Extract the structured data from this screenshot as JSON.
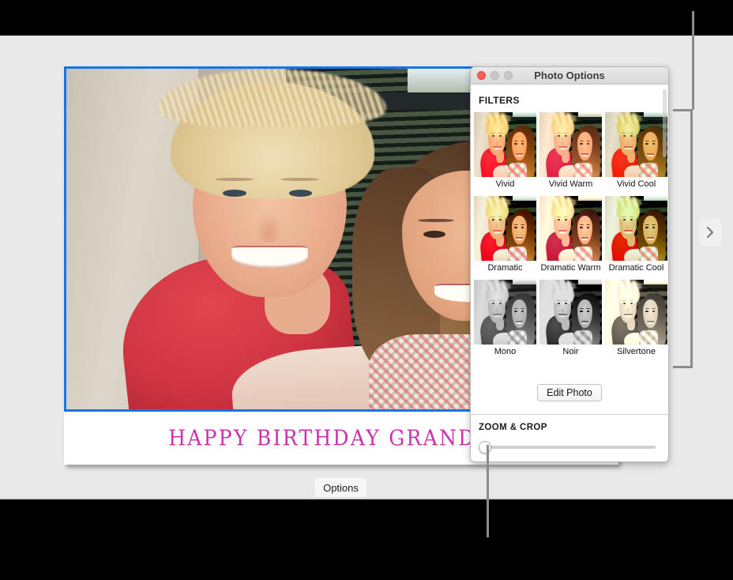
{
  "slide": {
    "caption_text": "HAPPY BIRTHDAY GRANDMA",
    "caption_color": "#cc2fae",
    "selection_border_color": "#1a73e8",
    "photo_alt": "Grandmother with short blonde hair hugging a smiling girl with long brown hair, outdoors by a concrete wall and dark louvered window"
  },
  "toolbar": {
    "options_label": "Options"
  },
  "nav": {
    "next_icon": "chevron-right-icon"
  },
  "panel": {
    "title": "Photo Options",
    "window_controls": {
      "close": "close-button",
      "minimize": "minimize-button",
      "zoom": "zoom-button"
    },
    "filters_heading": "FILTERS",
    "filters": [
      {
        "label": "Vivid",
        "style": "f-vivid"
      },
      {
        "label": "Vivid Warm",
        "style": "f-vividwarm"
      },
      {
        "label": "Vivid Cool",
        "style": "f-vividcool"
      },
      {
        "label": "Dramatic",
        "style": "f-dramatic"
      },
      {
        "label": "Dramatic Warm",
        "style": "f-dramwarm"
      },
      {
        "label": "Dramatic Cool",
        "style": "f-dramcool"
      },
      {
        "label": "Mono",
        "style": "f-mono"
      },
      {
        "label": "Noir",
        "style": "f-noir"
      },
      {
        "label": "Silvertone",
        "style": "f-silver"
      }
    ],
    "edit_photo_label": "Edit Photo",
    "zoom_crop_heading": "ZOOM & CROP",
    "zoom_crop_value": 0
  }
}
